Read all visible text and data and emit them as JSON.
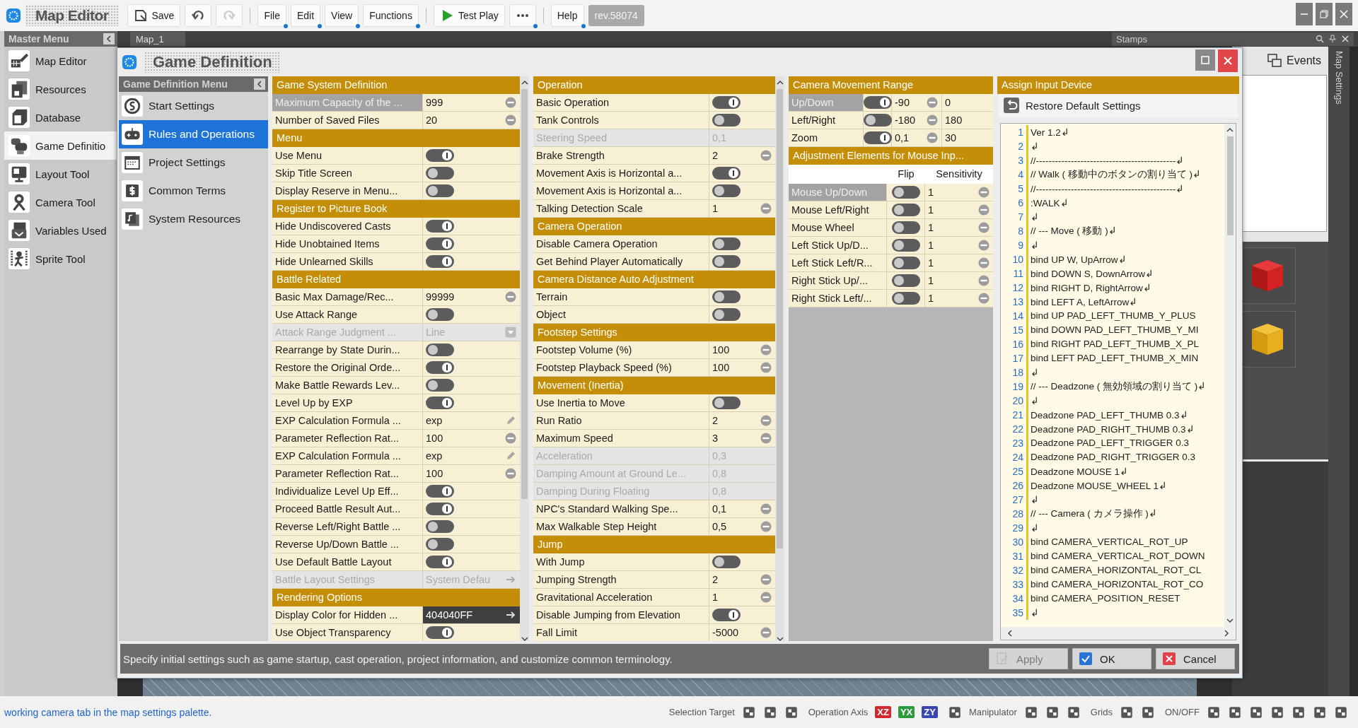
{
  "toolbar": {
    "app_title": "Map Editor",
    "save": "Save",
    "history": [
      {
        "kind": "undo",
        "disabled": false
      },
      {
        "kind": "redo",
        "disabled": true
      }
    ],
    "menus": [
      "File",
      "Edit",
      "View",
      "Functions"
    ],
    "test_play": "Test Play",
    "help": "Help",
    "revision": "rev.58074"
  },
  "master_menu": {
    "title": "Master Menu",
    "items": [
      {
        "label": "Map Editor",
        "selected": false
      },
      {
        "label": "Resources",
        "selected": false
      },
      {
        "label": "Database",
        "selected": false
      },
      {
        "label": "Game Definitio",
        "selected": true
      },
      {
        "label": "Layout Tool",
        "selected": false
      },
      {
        "label": "Camera Tool",
        "selected": false
      },
      {
        "label": "Variables Used",
        "selected": false
      },
      {
        "label": "Sprite Tool",
        "selected": false
      }
    ]
  },
  "map_tab": "Map_1",
  "stamps_title": "Stamps",
  "dialog": {
    "title": "Game Definition",
    "menu": {
      "title": "Game Definition Menu",
      "items": [
        {
          "label": "Start Settings",
          "selected": false
        },
        {
          "label": "Rules and Operations",
          "selected": true
        },
        {
          "label": "Project Settings",
          "selected": false
        },
        {
          "label": "Common Terms",
          "selected": false
        },
        {
          "label": "System Resources",
          "selected": false
        }
      ]
    },
    "columns": [
      {
        "sections": [
          {
            "title": "Game System Definition",
            "rows": [
              {
                "label": "Maximum Capacity of the ...",
                "kind": "number",
                "value": "999",
                "selected": true,
                "disabled": false
              },
              {
                "label": "Number of Saved Files",
                "kind": "number",
                "value": "20",
                "selected": false,
                "disabled": false
              }
            ]
          },
          {
            "title": "Menu",
            "rows": [
              {
                "label": "Use Menu",
                "kind": "toggle",
                "on": true,
                "selected": false,
                "disabled": false
              },
              {
                "label": "Skip Title Screen",
                "kind": "toggle",
                "on": false,
                "selected": false,
                "disabled": false
              },
              {
                "label": "Display Reserve in Menu...",
                "kind": "toggle",
                "on": false,
                "selected": false,
                "disabled": false
              }
            ]
          },
          {
            "title": "Register to Picture Book",
            "rows": [
              {
                "label": "Hide Undiscovered Casts",
                "kind": "toggle",
                "on": true,
                "selected": false,
                "disabled": false
              },
              {
                "label": "Hide Unobtained Items",
                "kind": "toggle",
                "on": true,
                "selected": false,
                "disabled": false
              },
              {
                "label": "Hide Unlearned Skills",
                "kind": "toggle",
                "on": true,
                "selected": false,
                "disabled": false
              }
            ]
          },
          {
            "title": "Battle Related",
            "rows": [
              {
                "label": "Basic Max Damage/Rec...",
                "kind": "number",
                "value": "99999",
                "selected": false,
                "disabled": false
              },
              {
                "label": "Use Attack Range",
                "kind": "toggle",
                "on": false,
                "selected": false,
                "disabled": false
              },
              {
                "label": "Attack Range Judgment ...",
                "kind": "dropdown",
                "value": "Line",
                "selected": false,
                "disabled": true
              },
              {
                "label": "Rearrange by State Durin...",
                "kind": "toggle",
                "on": false,
                "selected": false,
                "disabled": false
              },
              {
                "label": "Restore the Original Orde...",
                "kind": "toggle",
                "on": true,
                "selected": false,
                "disabled": false
              },
              {
                "label": "Make Battle Rewards Lev...",
                "kind": "toggle",
                "on": false,
                "selected": false,
                "disabled": false
              },
              {
                "label": "Level Up by EXP",
                "kind": "toggle",
                "on": true,
                "selected": false,
                "disabled": false
              },
              {
                "label": "EXP Calculation Formula ...",
                "kind": "formula",
                "value": "exp",
                "selected": false,
                "disabled": false
              },
              {
                "label": "Parameter Reflection Rat...",
                "kind": "number",
                "value": "100",
                "selected": false,
                "disabled": false
              },
              {
                "label": "EXP Calculation Formula ...",
                "kind": "formula",
                "value": "exp",
                "selected": false,
                "disabled": false
              },
              {
                "label": "Parameter Reflection Rat...",
                "kind": "number",
                "value": "100",
                "selected": false,
                "disabled": false
              },
              {
                "label": "Individualize Level Up Eff...",
                "kind": "toggle",
                "on": true,
                "selected": false,
                "disabled": false
              },
              {
                "label": "Proceed Battle Result Aut...",
                "kind": "toggle",
                "on": true,
                "selected": false,
                "disabled": false
              },
              {
                "label": "Reverse Left/Right Battle ...",
                "kind": "toggle",
                "on": false,
                "selected": false,
                "disabled": false
              },
              {
                "label": "Reverse Up/Down Battle ...",
                "kind": "toggle",
                "on": false,
                "selected": false,
                "disabled": false
              },
              {
                "label": "Use Default Battle Layout",
                "kind": "toggle",
                "on": true,
                "selected": false,
                "disabled": false
              },
              {
                "label": "Battle Layout Settings",
                "kind": "link",
                "value": "System Defau",
                "selected": false,
                "disabled": true
              }
            ]
          },
          {
            "title": "Rendering Options",
            "rows": [
              {
                "label": "Display Color for Hidden ...",
                "kind": "color",
                "value": "404040FF",
                "selected": false,
                "disabled": false
              },
              {
                "label": "Use Object Transparency",
                "kind": "toggle",
                "on": true,
                "selected": false,
                "disabled": false
              }
            ]
          }
        ]
      },
      {
        "sections": [
          {
            "title": "Operation",
            "rows": [
              {
                "label": "Basic Operation",
                "kind": "toggle",
                "on": true,
                "selected": false,
                "disabled": false
              },
              {
                "label": "Tank Controls",
                "kind": "toggle",
                "on": false,
                "selected": false,
                "disabled": false
              },
              {
                "label": "Steering Speed",
                "kind": "number",
                "value": "0,1",
                "selected": false,
                "disabled": true
              },
              {
                "label": "Brake Strength",
                "kind": "number",
                "value": "2",
                "selected": false,
                "disabled": false
              },
              {
                "label": "Movement Axis is Horizontal a...",
                "kind": "toggle",
                "on": true,
                "selected": false,
                "disabled": false
              },
              {
                "label": "Movement Axis is Horizontal a...",
                "kind": "toggle",
                "on": false,
                "selected": false,
                "disabled": false
              },
              {
                "label": "Talking Detection Scale",
                "kind": "number",
                "value": "1",
                "selected": false,
                "disabled": false
              }
            ]
          },
          {
            "title": "Camera Operation",
            "rows": [
              {
                "label": "Disable Camera Operation",
                "kind": "toggle",
                "on": false,
                "selected": false,
                "disabled": false
              },
              {
                "label": "Get Behind Player Automatically",
                "kind": "toggle",
                "on": false,
                "selected": false,
                "disabled": false
              }
            ]
          },
          {
            "title": "Camera Distance Auto Adjustment",
            "rows": [
              {
                "label": "Terrain",
                "kind": "toggle",
                "on": false,
                "selected": false,
                "disabled": false
              },
              {
                "label": "Object",
                "kind": "toggle",
                "on": false,
                "selected": false,
                "disabled": false
              }
            ]
          },
          {
            "title": "Footstep Settings",
            "rows": [
              {
                "label": "Footstep Volume (%)",
                "kind": "number",
                "value": "100",
                "selected": false,
                "disabled": false
              },
              {
                "label": "Footstep Playback Speed (%)",
                "kind": "number",
                "value": "100",
                "selected": false,
                "disabled": false
              }
            ]
          },
          {
            "title": "Movement (Inertia)",
            "rows": [
              {
                "label": "Use Inertia to Move",
                "kind": "toggle",
                "on": false,
                "selected": false,
                "disabled": false
              },
              {
                "label": "Run Ratio",
                "kind": "number",
                "value": "2",
                "selected": false,
                "disabled": false
              },
              {
                "label": "Maximum Speed",
                "kind": "number",
                "value": "3",
                "selected": false,
                "disabled": false
              },
              {
                "label": "Acceleration",
                "kind": "number",
                "value": "0,3",
                "selected": false,
                "disabled": true
              },
              {
                "label": "Damping Amount at Ground Le...",
                "kind": "number",
                "value": "0,8",
                "selected": false,
                "disabled": true
              },
              {
                "label": "Damping During Floating",
                "kind": "number",
                "value": "0,8",
                "selected": false,
                "disabled": true
              },
              {
                "label": "NPC's Standard Walking Spe...",
                "kind": "number",
                "value": "0,1",
                "selected": false,
                "disabled": false
              },
              {
                "label": "Max Walkable Step Height",
                "kind": "number",
                "value": "0,5",
                "selected": false,
                "disabled": false
              }
            ]
          },
          {
            "title": "Jump",
            "rows": [
              {
                "label": "With Jump",
                "kind": "toggle",
                "on": false,
                "selected": false,
                "disabled": false
              },
              {
                "label": "Jumping Strength",
                "kind": "number",
                "value": "2",
                "selected": false,
                "disabled": false
              },
              {
                "label": "Gravitational Acceleration",
                "kind": "number",
                "value": "1",
                "selected": false,
                "disabled": false
              },
              {
                "label": "Disable Jumping from Elevation",
                "kind": "toggle",
                "on": true,
                "selected": false,
                "disabled": false
              },
              {
                "label": "Fall Limit",
                "kind": "number",
                "value": "-5000",
                "selected": false,
                "disabled": false
              }
            ]
          }
        ]
      }
    ],
    "camera_range": {
      "title": "Camera Movement Range",
      "rows": [
        {
          "label": "Up/Down",
          "on": true,
          "min": "-90",
          "max": "0",
          "selected": true
        },
        {
          "label": "Left/Right",
          "on": false,
          "min": "-180",
          "max": "180",
          "selected": false
        },
        {
          "label": "Zoom",
          "on": true,
          "min": "0,1",
          "max": "30",
          "selected": false
        }
      ]
    },
    "mouse_adjust": {
      "title": "Adjustment Elements for Mouse Inp...",
      "columns": [
        "Flip",
        "Sensitivity"
      ],
      "rows": [
        {
          "label": "Mouse Up/Down",
          "flip": false,
          "sensitivity": "1",
          "selected": true
        },
        {
          "label": "Mouse Left/Right",
          "flip": false,
          "sensitivity": "1",
          "selected": false
        },
        {
          "label": "Mouse Wheel",
          "flip": false,
          "sensitivity": "1",
          "selected": false
        },
        {
          "label": "Left Stick Up/D...",
          "flip": false,
          "sensitivity": "1",
          "selected": false
        },
        {
          "label": "Left Stick Left/R...",
          "flip": false,
          "sensitivity": "1",
          "selected": false
        },
        {
          "label": "Right Stick Up/...",
          "flip": false,
          "sensitivity": "1",
          "selected": false
        },
        {
          "label": "Right Stick Left/...",
          "flip": false,
          "sensitivity": "1",
          "selected": false
        }
      ]
    },
    "input_device": {
      "title": "Assign Input Device",
      "restore": "Restore Default Settings",
      "lines": [
        {
          "number": "1",
          "text": "Ver 1.2↲"
        },
        {
          "number": "2",
          "text": "↲"
        },
        {
          "number": "3",
          "text": "//--------------------------------------------↲"
        },
        {
          "number": "4",
          "text": "// Walk ( 移動中のボタンの割り当て )↲"
        },
        {
          "number": "5",
          "text": "//--------------------------------------------↲"
        },
        {
          "number": "6",
          "text": ":WALK↲"
        },
        {
          "number": "7",
          "text": "↲"
        },
        {
          "number": "8",
          "text": "// --- Move ( 移動 )↲"
        },
        {
          "number": "9",
          "text": "↲"
        },
        {
          "number": "10",
          "text": "bind UP W, UpArrow↲"
        },
        {
          "number": "11",
          "text": "bind DOWN S, DownArrow↲"
        },
        {
          "number": "12",
          "text": "bind RIGHT D, RightArrow↲"
        },
        {
          "number": "13",
          "text": "bind LEFT A, LeftArrow↲"
        },
        {
          "number": "14",
          "text": "bind UP PAD_LEFT_THUMB_Y_PLUS"
        },
        {
          "number": "15",
          "text": "bind DOWN PAD_LEFT_THUMB_Y_MI"
        },
        {
          "number": "16",
          "text": "bind RIGHT PAD_LEFT_THUMB_X_PL"
        },
        {
          "number": "17",
          "text": "bind LEFT PAD_LEFT_THUMB_X_MIN"
        },
        {
          "number": "18",
          "text": "↲"
        },
        {
          "number": "19",
          "text": "// --- Deadzone ( 無効領域の割り当て )↲"
        },
        {
          "number": "20",
          "text": "↲"
        },
        {
          "number": "21",
          "text": "Deadzone PAD_LEFT_THUMB 0.3↲"
        },
        {
          "number": "22",
          "text": "Deadzone PAD_RIGHT_THUMB 0.3↲"
        },
        {
          "number": "23",
          "text": "Deadzone PAD_LEFT_TRIGGER 0.3"
        },
        {
          "number": "24",
          "text": "Deadzone PAD_RIGHT_TRIGGER 0.3"
        },
        {
          "number": "25",
          "text": "Deadzone MOUSE 1↲"
        },
        {
          "number": "26",
          "text": "Deadzone MOUSE_WHEEL 1↲"
        },
        {
          "number": "27",
          "text": "↲"
        },
        {
          "number": "28",
          "text": "// --- Camera ( カメラ操作 )↲"
        },
        {
          "number": "29",
          "text": "↲"
        },
        {
          "number": "30",
          "text": "bind CAMERA_VERTICAL_ROT_UP"
        },
        {
          "number": "31",
          "text": "bind CAMERA_VERTICAL_ROT_DOWN"
        },
        {
          "number": "32",
          "text": "bind CAMERA_HORIZONTAL_ROT_CL"
        },
        {
          "number": "33",
          "text": "bind CAMERA_HORIZONTAL_ROT_CO"
        },
        {
          "number": "34",
          "text": "bind CAMERA_POSITION_RESET"
        },
        {
          "number": "35",
          "text": "↲"
        }
      ]
    },
    "description": "Specify initial settings such as game startup, cast operation, project information, and customize common terminology.",
    "buttons": [
      {
        "label": "Apply",
        "kind": "apply",
        "disabled": true
      },
      {
        "label": "OK",
        "kind": "ok",
        "disabled": false
      },
      {
        "label": "Cancel",
        "kind": "cancel",
        "disabled": false
      }
    ]
  },
  "events_tab": "Events",
  "map_settings_tab": "Map Settings",
  "status_bar": {
    "message": "working camera tab in the map settings palette.",
    "groups": [
      {
        "kind": "selection",
        "label": "Selection Target"
      },
      {
        "kind": "axis",
        "label": "Operation Axis",
        "axes": [
          {
            "label": "XZ",
            "color": "#d0282c"
          },
          {
            "label": "YX",
            "color": "#2c9a3c"
          },
          {
            "label": "ZY",
            "color": "#3848b0"
          }
        ]
      },
      {
        "kind": "manipulator",
        "label": "Manipulator"
      },
      {
        "kind": "grids",
        "label": "Grids"
      },
      {
        "kind": "toggles",
        "label": "ON/OFF"
      }
    ]
  }
}
